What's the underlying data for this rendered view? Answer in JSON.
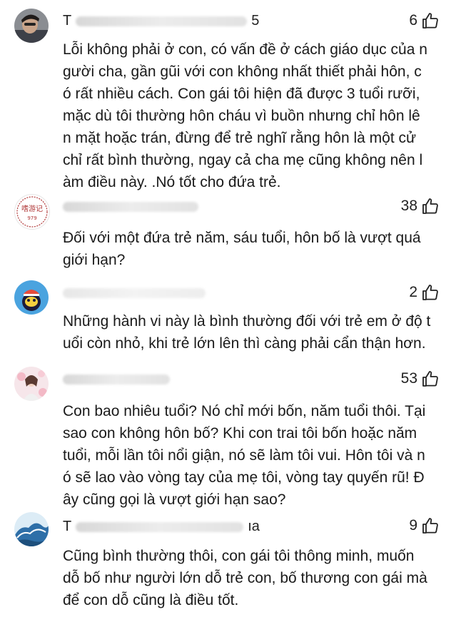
{
  "comments": [
    {
      "username": "T",
      "username_tail": "5",
      "likes": "6",
      "avatar_icon": "man-portrait-avatar",
      "text": "Lỗi không phải ở con, có vấn đề ở cách giáo dục của n\người cha, gần gũi với con không nhất thiết phải hôn, c\nó rất nhiều cách. Con gái tôi hiện đã được 3 tuổi rưỡi,\nmặc dù tôi thường hôn cháu vì buồn nhưng chỉ hôn lê\nn mặt hoặc trán, đừng để trẻ nghĩ rằng hôn là một cử\nchỉ rất bình thường, ngay cả cha mẹ cũng không nên l\nàm điều này. .Nó tốt cho đứa trẻ."
    },
    {
      "username": "",
      "username_tail": "",
      "likes": "38",
      "avatar_icon": "stamp-logo-avatar",
      "avatar_text": "嗜游记",
      "avatar_number": "979",
      "text": "Đối với một đứa trẻ năm, sáu tuổi, hôn bố là vượt quá\ngiới hạn?"
    },
    {
      "username": "",
      "username_tail": "",
      "likes": "2",
      "avatar_icon": "cartoon-character-avatar",
      "text": "Những hành vi này là bình thường đối với trẻ em ở độ t\nuổi còn nhỏ, khi trẻ lớn lên thì càng phải cẩn thận hơn."
    },
    {
      "username": "",
      "username_tail": "",
      "likes": "53",
      "avatar_icon": "woman-flowers-avatar",
      "text": "Con bao nhiêu tuổi? Nó chỉ mới bốn, năm tuổi thôi. Tại\nsao con không hôn bố? Khi con trai tôi bốn hoặc năm\ntuổi, mỗi lần tôi nổi giận, nó sẽ làm tôi vui. Hôn tôi và n\nó sẽ lao vào vòng tay của mẹ tôi, vòng tay quyến rũ! Đ\nây cũng gọi là vượt giới hạn sao?"
    },
    {
      "username": "T",
      "username_tail": "ıa",
      "likes": "9",
      "avatar_icon": "ocean-wave-avatar",
      "text": "Cũng bình thường thôi, con gái tôi thông minh, muốn\ndỗ bố như người lớn dỗ trẻ con, bố thương con gái mà\nđể con dỗ cũng là điều tốt."
    }
  ]
}
